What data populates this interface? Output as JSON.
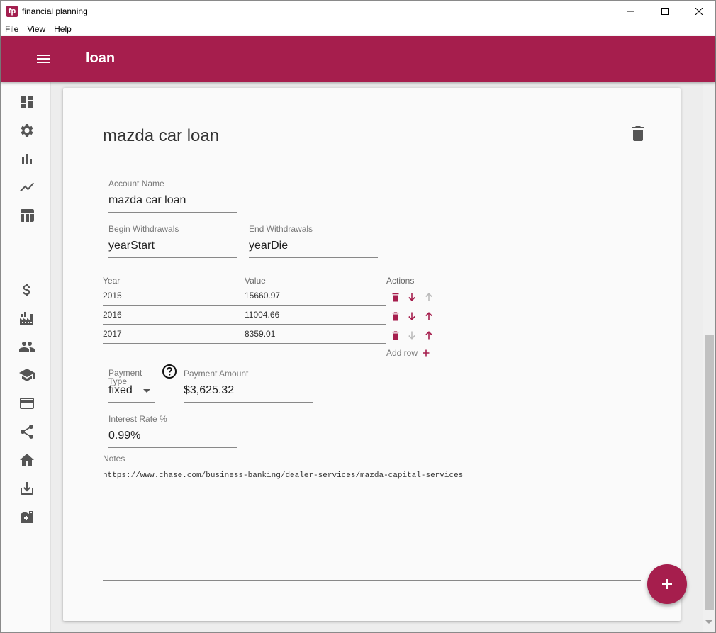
{
  "window": {
    "app_icon_text": "fp",
    "title": "financial planning"
  },
  "menu": [
    "File",
    "View",
    "Help"
  ],
  "header": {
    "title": "loan"
  },
  "sidebar": {
    "top_icons": [
      "dashboard-icon",
      "settings-icon",
      "bar-chart-icon",
      "trending-icon",
      "table-icon"
    ],
    "bottom_icons": [
      "dollar-icon",
      "factory-icon",
      "people-icon",
      "school-icon",
      "credit-card-icon",
      "share-icon",
      "home-icon",
      "download-icon",
      "hospital-icon"
    ]
  },
  "card": {
    "title": "mazda car loan",
    "account_name": {
      "label": "Account Name",
      "value": "mazda car loan"
    },
    "begin_withdrawals": {
      "label": "Begin Withdrawals",
      "value": "yearStart"
    },
    "end_withdrawals": {
      "label": "End Withdrawals",
      "value": "yearDie"
    },
    "table": {
      "headers": [
        "Year",
        "Value",
        "Actions"
      ],
      "rows": [
        {
          "year": "2015",
          "value": "15660.97"
        },
        {
          "year": "2016",
          "value": "11004.66"
        },
        {
          "year": "2017",
          "value": "8359.01"
        }
      ],
      "add_row_label": "Add row"
    },
    "payment_type": {
      "label": "Payment Type",
      "value": "fixed"
    },
    "payment_amount": {
      "label": "Payment Amount",
      "value": "$3,625.32"
    },
    "interest_rate": {
      "label": "Interest Rate %",
      "value": "0.99%"
    },
    "notes": {
      "label": "Notes",
      "value": "https://www.chase.com/business-banking/dealer-services/mazda-capital-services"
    }
  },
  "colors": {
    "accent": "#a61e4d",
    "icon_gray": "#555555",
    "disabled_gray": "#bbbbbb"
  }
}
